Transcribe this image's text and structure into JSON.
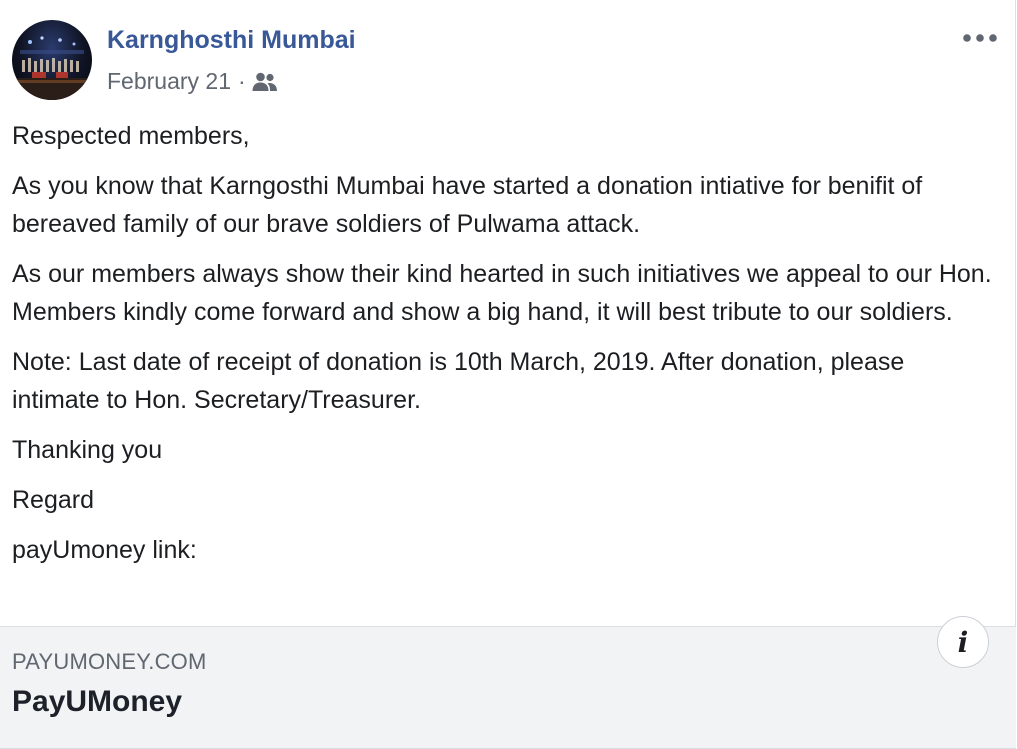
{
  "post": {
    "author": "Karnghosthi Mumbai",
    "date": "February 21",
    "separator": "·",
    "audience_icon": "group-members-icon",
    "more_icon": "more-options-icon"
  },
  "content": {
    "paragraphs": [
      "Respected members,",
      "As you know that Karngosthi Mumbai have started a donation intiative for benifit of bereaved family of our brave soldiers of Pulwama attack.",
      "As our members always show their kind hearted in such initiatives we appeal to our Hon. Members kindly come forward and show a big hand, it will best tribute to our soldiers.",
      "Note: Last date of receipt of donation is 10th March, 2019. After donation, please intimate to Hon. Secretary/Treasurer.",
      "Thanking you",
      "Regard",
      "payUmoney link:"
    ]
  },
  "link_preview": {
    "domain": "PAYUMONEY.COM",
    "title": "PayUMoney",
    "info_label": "i",
    "background": "#f2f3f5"
  },
  "colors": {
    "author": "#385898",
    "meta": "#606770",
    "text": "#1c1e21"
  }
}
